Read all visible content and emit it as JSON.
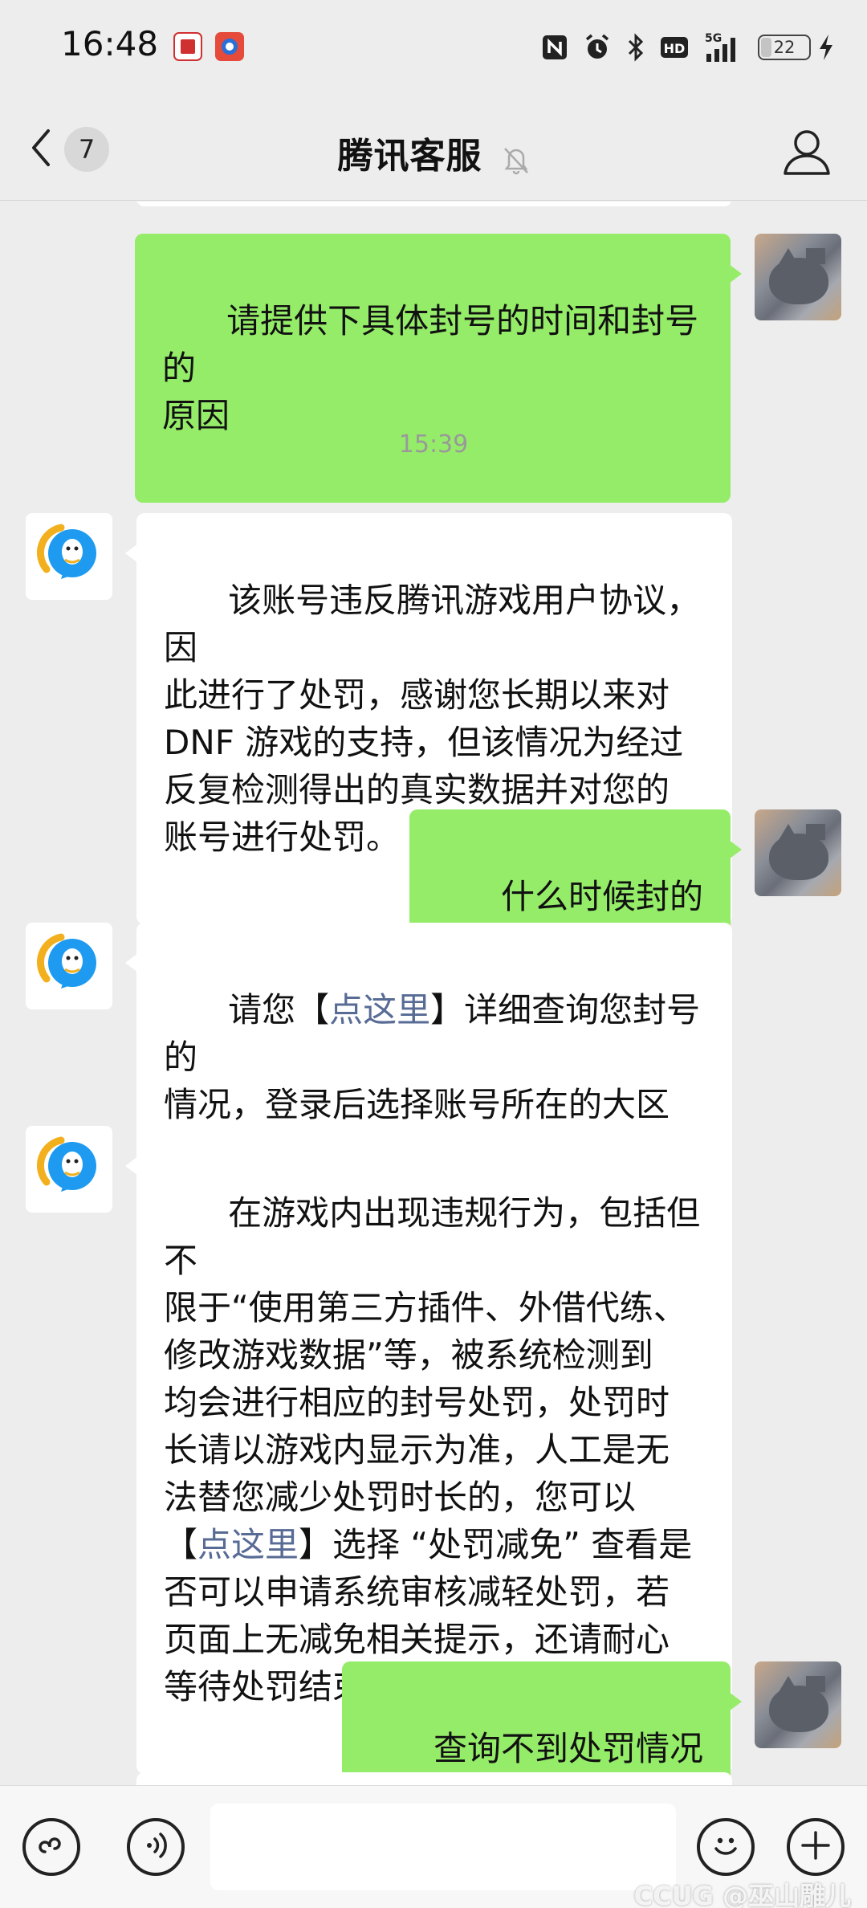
{
  "status_bar": {
    "time": "16:48",
    "battery": "22",
    "icons": [
      "nfc-icon",
      "alarm-icon",
      "bluetooth-icon",
      "hd-icon",
      "5g-signal-icon",
      "battery-icon",
      "charging-icon"
    ]
  },
  "header": {
    "back_count": "7",
    "title": "腾讯客服",
    "icons": [
      "back-arrow-icon",
      "mute-bell-icon",
      "profile-icon"
    ]
  },
  "chat": {
    "messages": [
      {
        "sender": "me",
        "text": "请提供下具体封号的时间和封号的\n原因"
      },
      {
        "type": "timestamp",
        "text": "15:39"
      },
      {
        "sender": "them",
        "text": "该账号违反腾讯游戏用户协议，因\n此进行了处罚，感谢您长期以来对\nDNF 游戏的支持，但该情况为经过\n反复检测得出的真实数据并对您的\n账号进行处罚。"
      },
      {
        "sender": "me",
        "text": "什么时候封的"
      },
      {
        "sender": "them",
        "pre": "请您【",
        "link": "点这里",
        "post": "】详细查询您封号的\n情况，登录后选择账号所在的大区\n和角色信息即可查询。"
      },
      {
        "sender": "them",
        "pre": "在游戏内出现违规行为，包括但不\n限于“使用第三方插件、外借代练、\n修改游戏数据”等，被系统检测到\n均会进行相应的封号处罚，处罚时\n长请以游戏内显示为准，人工是无\n法替您减少处罚时长的，您可以\n【",
        "link": "点这里",
        "post": "】选择 “处罚减免” 查看是\n否可以申请系统审核减轻处罚，若\n页面上无减免相关提示，还请耐心\n等待处罚结束。"
      },
      {
        "sender": "me",
        "text": "查询不到处罚情况"
      }
    ]
  },
  "input_bar": {
    "icons": [
      "mini-program-icon",
      "voice-icon",
      "emoji-icon",
      "plus-icon"
    ],
    "input_value": ""
  },
  "watermark": "CCUG @巫山雕儿",
  "colors": {
    "background": "#ededed",
    "my_bubble": "#95ec69",
    "their_bubble": "#ffffff",
    "link": "#576b95"
  }
}
